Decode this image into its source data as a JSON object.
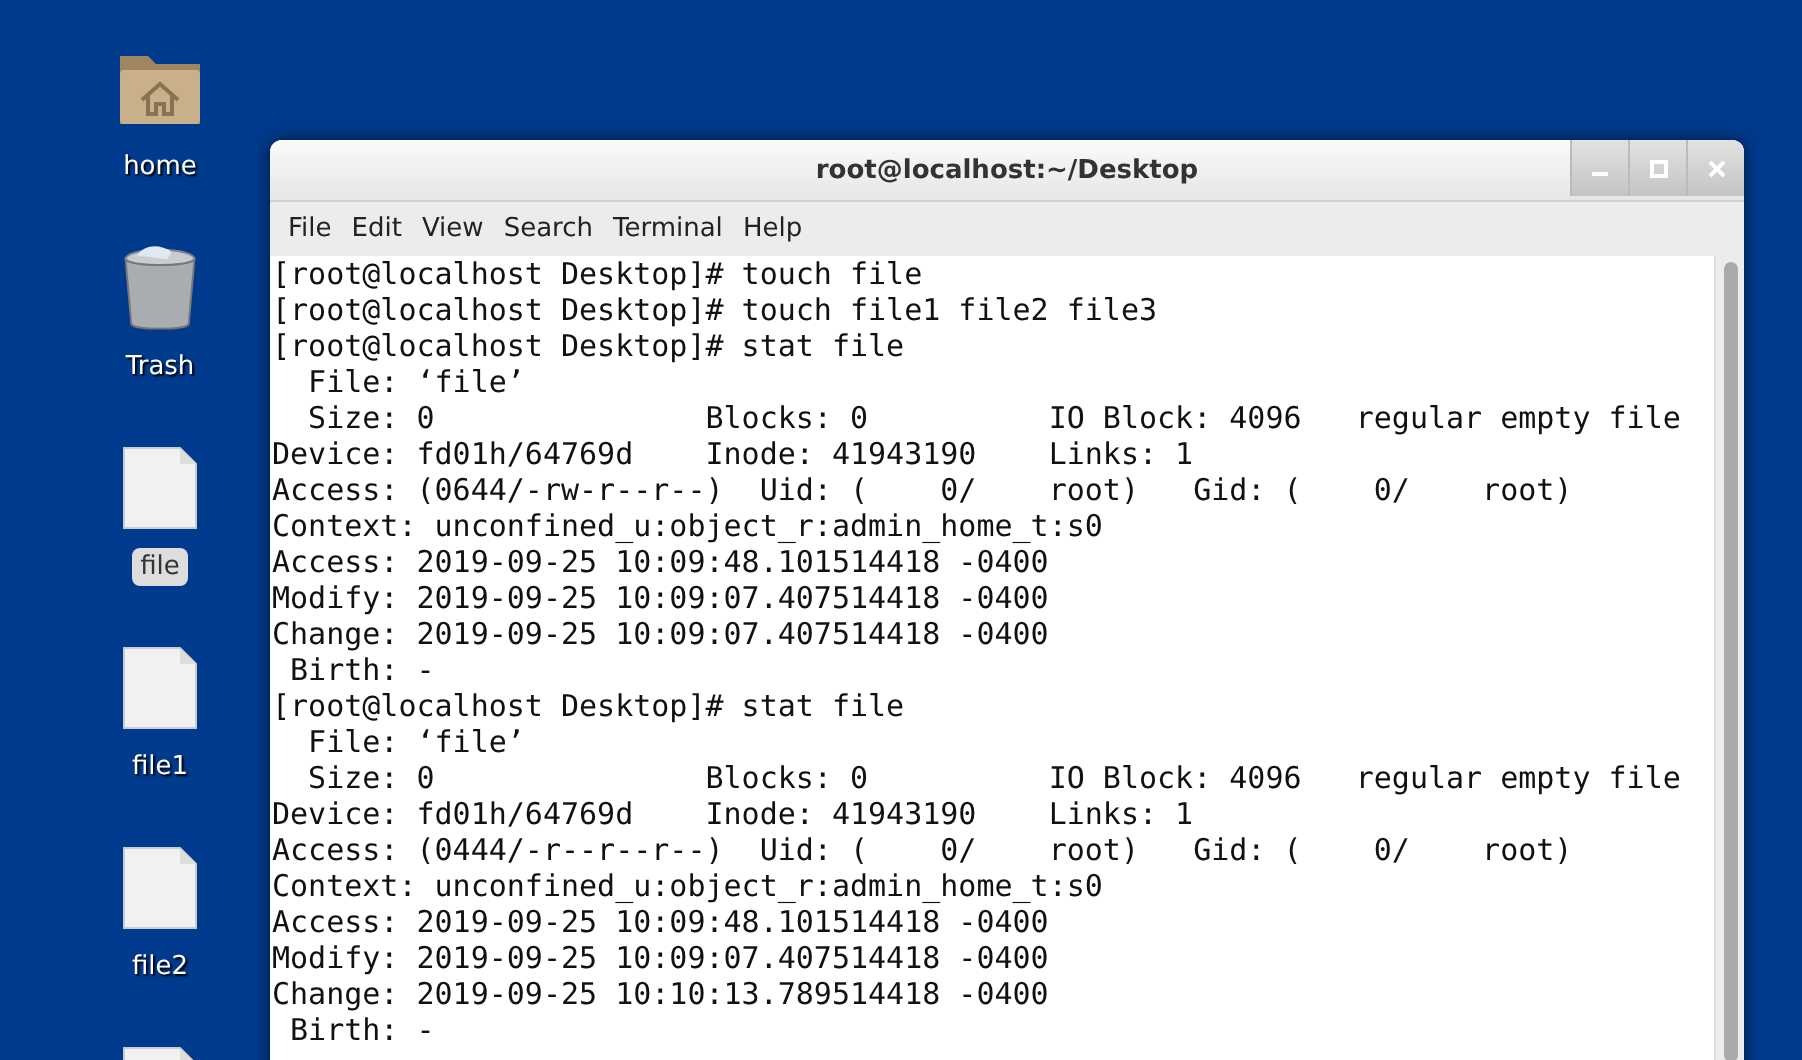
{
  "desktop_icons": [
    {
      "label": "home",
      "kind": "folder",
      "selected": false
    },
    {
      "label": "Trash",
      "kind": "trash",
      "selected": false
    },
    {
      "label": "file",
      "kind": "file",
      "selected": true
    },
    {
      "label": "file1",
      "kind": "file",
      "selected": false
    },
    {
      "label": "file2",
      "kind": "file",
      "selected": false
    },
    {
      "kind": "file"
    }
  ],
  "window": {
    "title": "root@localhost:~/Desktop",
    "menu": [
      "File",
      "Edit",
      "View",
      "Search",
      "Terminal",
      "Help"
    ],
    "lines": [
      "[root@localhost Desktop]# touch file",
      "[root@localhost Desktop]# touch file1 file2 file3",
      "[root@localhost Desktop]# stat file",
      "  File: ‘file’",
      "  Size: 0               Blocks: 0          IO Block: 4096   regular empty file",
      "Device: fd01h/64769d    Inode: 41943190    Links: 1",
      "Access: (0644/-rw-r--r--)  Uid: (    0/    root)   Gid: (    0/    root)",
      "Context: unconfined_u:object_r:admin_home_t:s0",
      "Access: 2019-09-25 10:09:48.101514418 -0400",
      "Modify: 2019-09-25 10:09:07.407514418 -0400",
      "Change: 2019-09-25 10:09:07.407514418 -0400",
      " Birth: -",
      "[root@localhost Desktop]# stat file",
      "  File: ‘file’",
      "  Size: 0               Blocks: 0          IO Block: 4096   regular empty file",
      "Device: fd01h/64769d    Inode: 41943190    Links: 1",
      "Access: (0444/-r--r--r--)  Uid: (    0/    root)   Gid: (    0/    root)",
      "Context: unconfined_u:object_r:admin_home_t:s0",
      "Access: 2019-09-25 10:09:48.101514418 -0400",
      "Modify: 2019-09-25 10:09:07.407514418 -0400",
      "Change: 2019-09-25 10:10:13.789514418 -0400",
      " Birth: -"
    ]
  }
}
